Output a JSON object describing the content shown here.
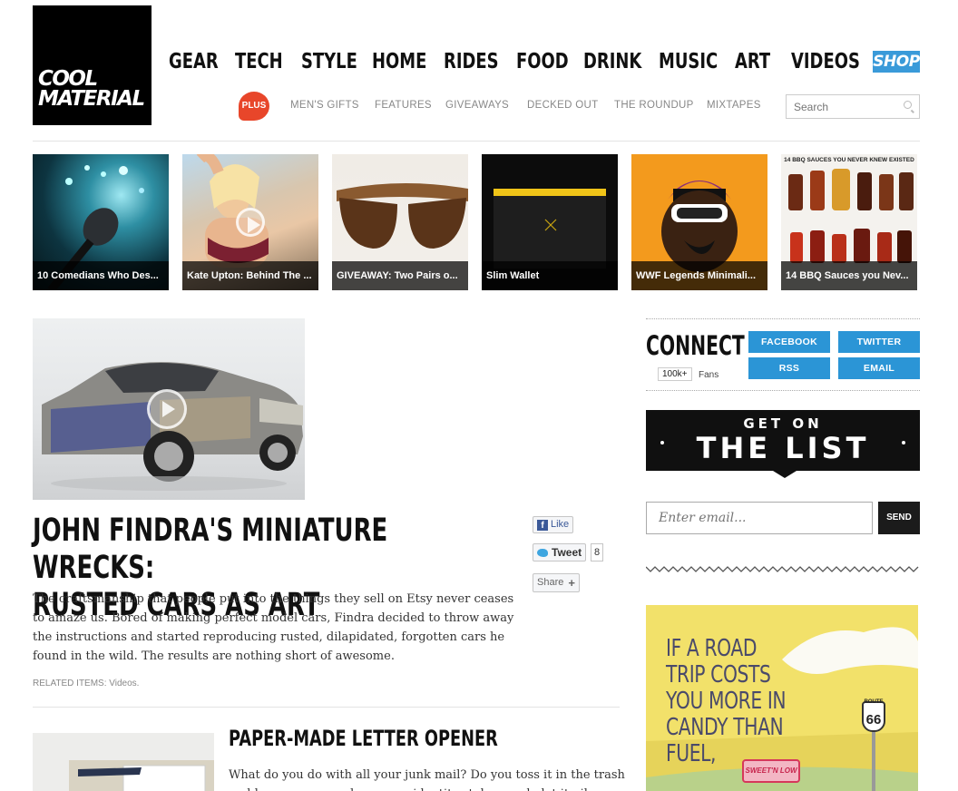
{
  "logo": {
    "line1": "COOL",
    "line2": "MATERIAL"
  },
  "nav": {
    "items": [
      "GEAR",
      "TECH",
      "STYLE",
      "HOME",
      "RIDES",
      "FOOD",
      "DRINK",
      "MUSIC",
      "ART",
      "VIDEOS"
    ],
    "shop": "SHOP"
  },
  "subnav": {
    "plus": "PLUS",
    "items": [
      "MEN'S GIFTS",
      "FEATURES",
      "GIVEAWAYS",
      "DECKED OUT",
      "THE ROUNDUP",
      "MIXTAPES"
    ]
  },
  "search": {
    "placeholder": "Search"
  },
  "thumbnails": [
    {
      "caption": "10 Comedians Who Des..."
    },
    {
      "caption": "Kate Upton: Behind The ..."
    },
    {
      "caption": "GIVEAWAY: Two Pairs o..."
    },
    {
      "caption": "Slim Wallet"
    },
    {
      "caption": "WWF Legends Minimali..."
    },
    {
      "caption": "14 BBQ Sauces you Nev..."
    }
  ],
  "thumb6_header": "14 BBQ SAUCES YOU NEVER KNEW EXISTED",
  "feature": {
    "title_line1": "JOHN FINDRA'S MINIATURE WRECKS:",
    "title_line2": "RUSTED CARS AS ART",
    "description": "The craftsmanship that people put into the things they sell on Etsy never ceases to amaze us. Bored of making perfect model cars, Findra decided to throw away the instructions and started reproducing rusted, dilapidated, forgotten cars he found in the wild. The results are nothing short of awesome.",
    "related_label": "RELATED ITEMS:",
    "related_value": "Videos."
  },
  "social": {
    "like": "Like",
    "tweet": "Tweet",
    "tweet_count": "8",
    "share": "Share"
  },
  "article2": {
    "title": "PAPER-MADE LETTER OPENER",
    "description": "What do you do with all your junk mail? Do you toss it in the trash and hope you never have your identity stolen, or do let it pile up on your"
  },
  "connect": {
    "title": "CONNECT",
    "fans_count": "100k+",
    "fans_label": "Fans",
    "buttons": [
      "FACEBOOK",
      "TWITTER",
      "RSS",
      "EMAIL"
    ],
    "accent": "#2b95d6"
  },
  "list_banner": {
    "line1": "GET ON",
    "line2": "THE LIST"
  },
  "newsletter": {
    "placeholder": "Enter email...",
    "send": "SEND"
  },
  "ad": {
    "text": "IF A ROAD TRIP COSTS YOU MORE IN CANDY THAN FUEL,",
    "route_label": "ROUTE",
    "route_number": "66",
    "brand": "SWEET'N LOW"
  }
}
